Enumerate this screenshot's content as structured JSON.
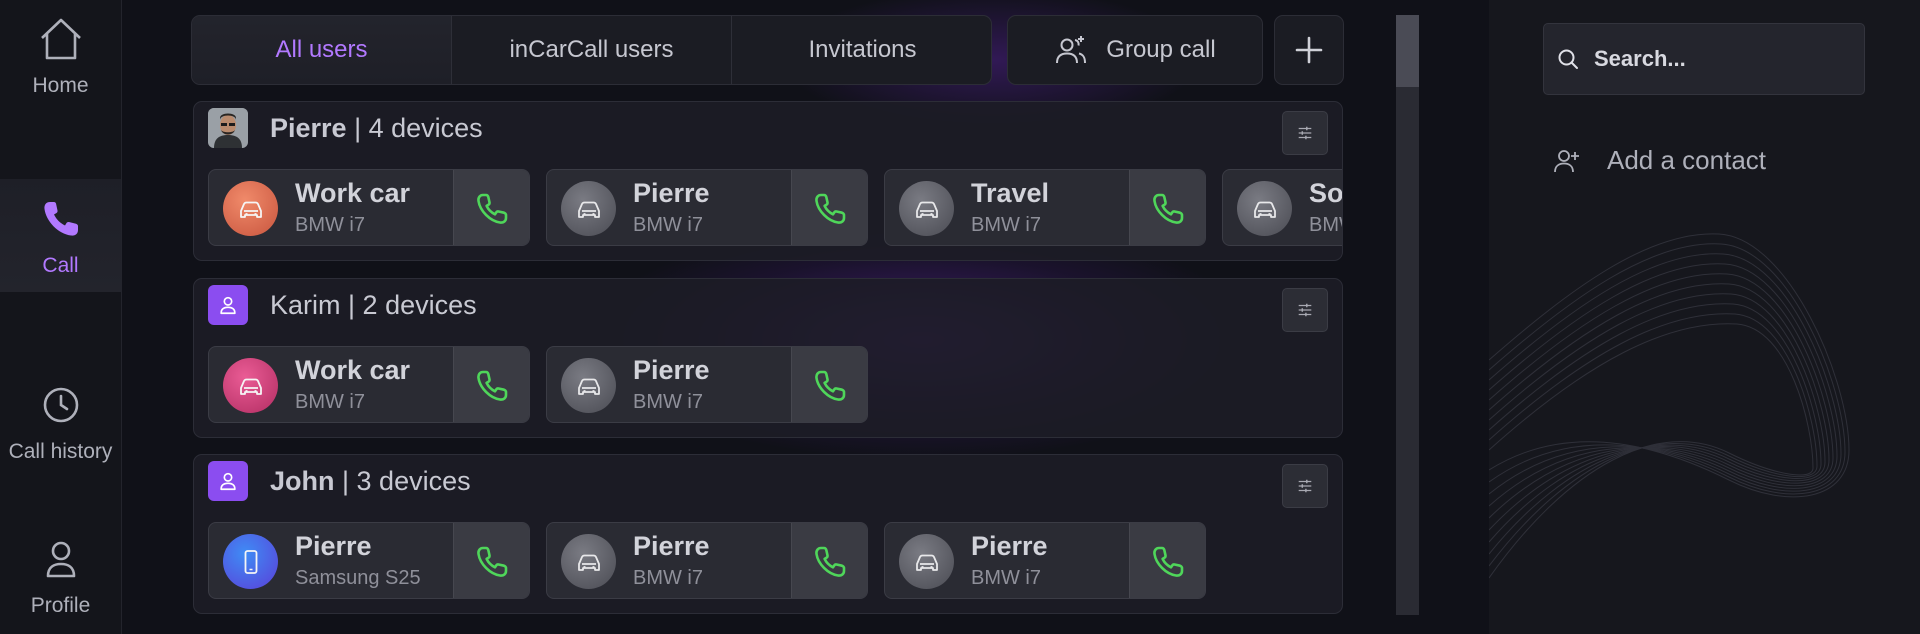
{
  "nav": {
    "items": [
      {
        "label": "Home",
        "icon": "home-icon",
        "active": false
      },
      {
        "label": "Call",
        "icon": "phone-icon",
        "active": true
      },
      {
        "label": "Call history",
        "icon": "clock-icon",
        "active": false
      },
      {
        "label": "Profile",
        "icon": "user-icon",
        "active": false
      }
    ]
  },
  "tabs": [
    {
      "label": "All users",
      "active": true
    },
    {
      "label": "inCarCall users",
      "active": false
    },
    {
      "label": "Invitations",
      "active": false
    }
  ],
  "toolbar": {
    "group_call_label": "Group call",
    "add_icon": "plus-icon"
  },
  "contacts": [
    {
      "name": "Pierre",
      "devices_text": "| 4 devices",
      "avatar": "photo",
      "devices": [
        {
          "name": "Work car",
          "model": "BMW i7",
          "icon": "car-icon",
          "color": "orange"
        },
        {
          "name": "Pierre",
          "model": "BMW i7",
          "icon": "car-icon",
          "color": "grey"
        },
        {
          "name": "Travel",
          "model": "BMW i7",
          "icon": "car-icon",
          "color": "grey"
        },
        {
          "name": "Sor",
          "model": "BMW",
          "icon": "car-icon",
          "color": "grey"
        }
      ]
    },
    {
      "name": "Karim",
      "devices_text": "| 2 devices",
      "avatar": "person",
      "devices": [
        {
          "name": "Work car",
          "model": "BMW i7",
          "icon": "car-icon",
          "color": "pink"
        },
        {
          "name": "Pierre",
          "model": "BMW i7",
          "icon": "car-icon",
          "color": "grey"
        }
      ]
    },
    {
      "name": "John",
      "devices_text": "| 3 devices",
      "avatar": "person",
      "devices": [
        {
          "name": "Pierre",
          "model": "Samsung S25",
          "icon": "smartphone-icon",
          "color": "blue"
        },
        {
          "name": "Pierre",
          "model": "BMW i7",
          "icon": "car-icon",
          "color": "grey"
        },
        {
          "name": "Pierre",
          "model": "BMW i7",
          "icon": "car-icon",
          "color": "grey"
        }
      ]
    }
  ],
  "search": {
    "placeholder": "Search..."
  },
  "add_contact_label": "Add a contact",
  "colors": {
    "accent": "#b279ff",
    "call_green": "#4fd65a",
    "avatar_purple": "#8b4df0"
  }
}
